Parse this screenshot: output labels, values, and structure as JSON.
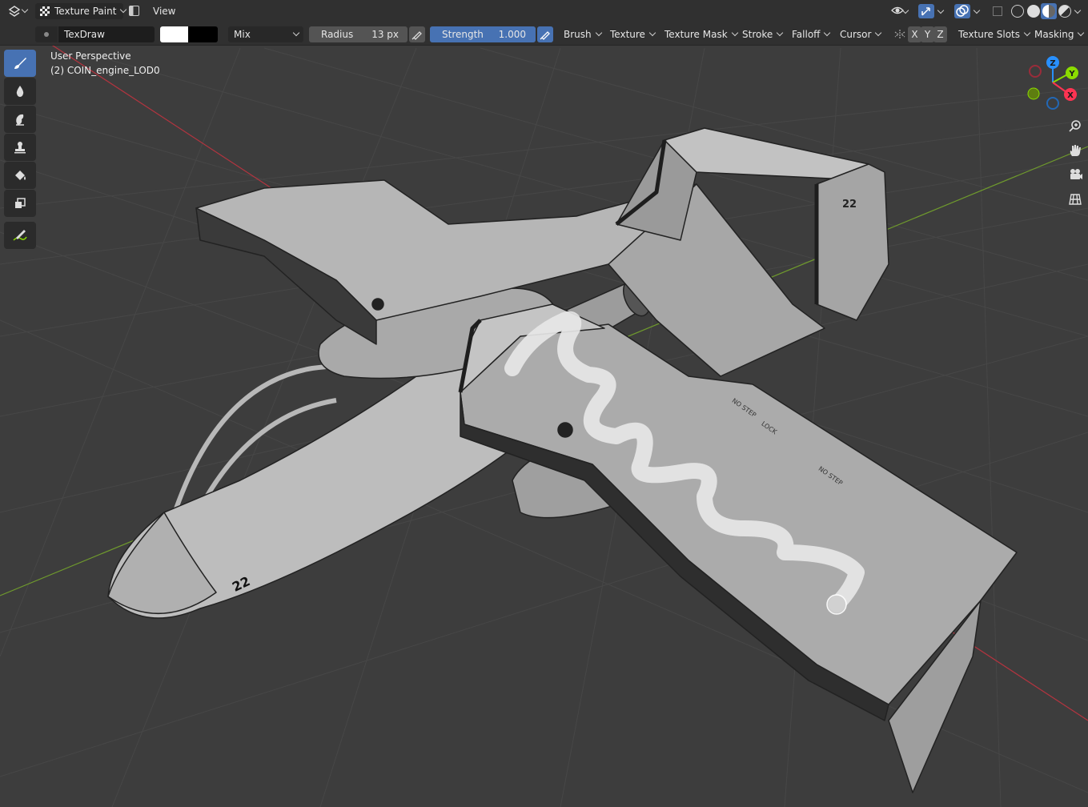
{
  "header": {
    "mode_label": "Texture Paint",
    "view_menu": "View"
  },
  "tool_settings": {
    "brush_name": "TexDraw",
    "blend_mode": "Mix",
    "radius_label": "Radius",
    "radius_value": "13 px",
    "strength_label": "Strength",
    "strength_value": "1.000",
    "strength_fraction": 1.0,
    "primary_color": "#ffffff",
    "secondary_color": "#000000",
    "menus": [
      "Brush",
      "Texture",
      "Texture Mask",
      "Stroke",
      "Falloff",
      "Cursor"
    ],
    "symmetry_axes": [
      "X",
      "Y",
      "Z"
    ],
    "texture_slots": "Texture Slots",
    "masking": "Masking"
  },
  "viewport": {
    "perspective": "User Perspective",
    "object_name": "(2) COIN_engine_LOD0",
    "gizmo_labels": {
      "z": "Z",
      "y": "Y",
      "x": "X"
    },
    "aircraft_number": "22",
    "wing_markings": [
      "NO STEP",
      "LOCK",
      "NO STEP"
    ]
  },
  "toolbar": {
    "tools": [
      "draw-tool",
      "soften-tool",
      "smear-tool",
      "clone-tool",
      "fill-tool",
      "mask-tool",
      "annotate-tool"
    ]
  },
  "colors": {
    "accent": "#4772b3",
    "axis_x": "#ff3352",
    "axis_y": "#8bdc00",
    "axis_z": "#2890ff",
    "header_bg": "#303030",
    "viewport_bg": "#3d3d3d"
  }
}
